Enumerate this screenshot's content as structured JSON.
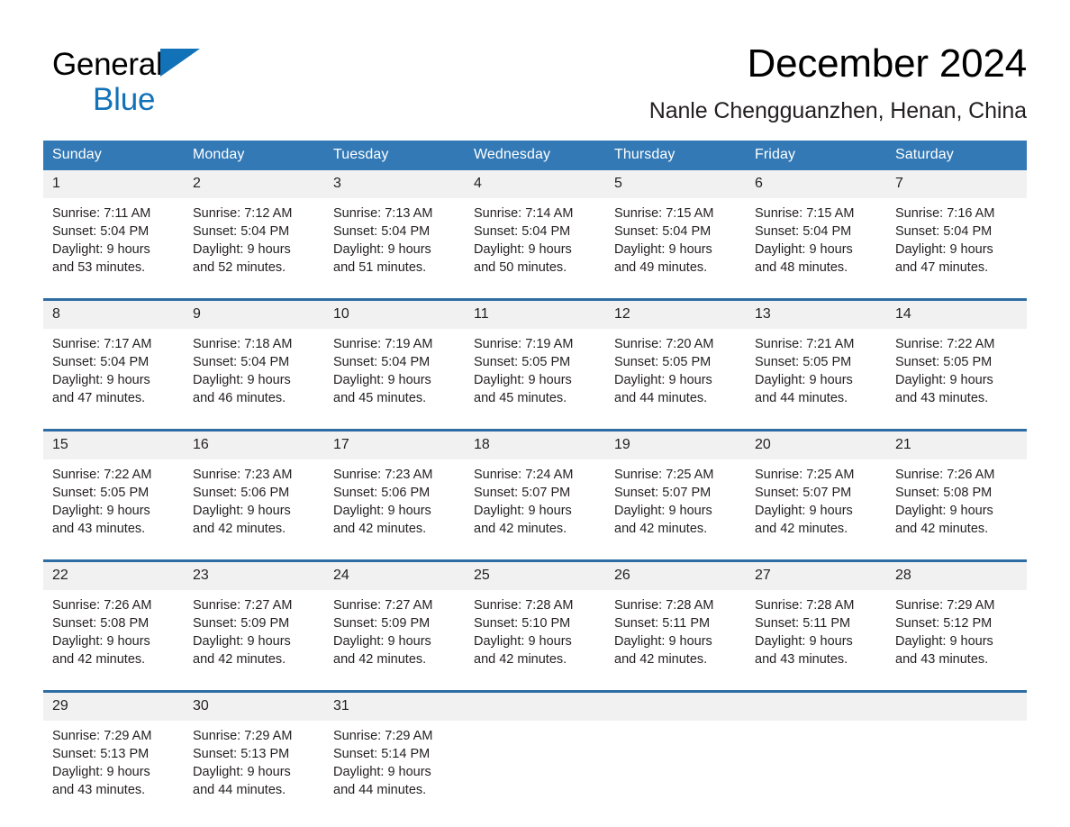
{
  "brand": {
    "name_part1": "General",
    "name_part2": "Blue",
    "triangle_color": "#1272b8",
    "logo_icon": "general-blue-logo-icon"
  },
  "header": {
    "title": "December 2024",
    "subtitle": "Nanle Chengguanzhen, Henan, China"
  },
  "theme": {
    "header_blue": "#3279b6",
    "divider_blue": "#2e6da4",
    "daynum_band": "#f1f1f1",
    "text": "#231f20"
  },
  "weekday_headers": [
    "Sunday",
    "Monday",
    "Tuesday",
    "Wednesday",
    "Thursday",
    "Friday",
    "Saturday"
  ],
  "weeks": [
    [
      {
        "day": "1",
        "sunrise": "Sunrise: 7:11 AM",
        "sunset": "Sunset: 5:04 PM",
        "daylight1": "Daylight: 9 hours",
        "daylight2": "and 53 minutes."
      },
      {
        "day": "2",
        "sunrise": "Sunrise: 7:12 AM",
        "sunset": "Sunset: 5:04 PM",
        "daylight1": "Daylight: 9 hours",
        "daylight2": "and 52 minutes."
      },
      {
        "day": "3",
        "sunrise": "Sunrise: 7:13 AM",
        "sunset": "Sunset: 5:04 PM",
        "daylight1": "Daylight: 9 hours",
        "daylight2": "and 51 minutes."
      },
      {
        "day": "4",
        "sunrise": "Sunrise: 7:14 AM",
        "sunset": "Sunset: 5:04 PM",
        "daylight1": "Daylight: 9 hours",
        "daylight2": "and 50 minutes."
      },
      {
        "day": "5",
        "sunrise": "Sunrise: 7:15 AM",
        "sunset": "Sunset: 5:04 PM",
        "daylight1": "Daylight: 9 hours",
        "daylight2": "and 49 minutes."
      },
      {
        "day": "6",
        "sunrise": "Sunrise: 7:15 AM",
        "sunset": "Sunset: 5:04 PM",
        "daylight1": "Daylight: 9 hours",
        "daylight2": "and 48 minutes."
      },
      {
        "day": "7",
        "sunrise": "Sunrise: 7:16 AM",
        "sunset": "Sunset: 5:04 PM",
        "daylight1": "Daylight: 9 hours",
        "daylight2": "and 47 minutes."
      }
    ],
    [
      {
        "day": "8",
        "sunrise": "Sunrise: 7:17 AM",
        "sunset": "Sunset: 5:04 PM",
        "daylight1": "Daylight: 9 hours",
        "daylight2": "and 47 minutes."
      },
      {
        "day": "9",
        "sunrise": "Sunrise: 7:18 AM",
        "sunset": "Sunset: 5:04 PM",
        "daylight1": "Daylight: 9 hours",
        "daylight2": "and 46 minutes."
      },
      {
        "day": "10",
        "sunrise": "Sunrise: 7:19 AM",
        "sunset": "Sunset: 5:04 PM",
        "daylight1": "Daylight: 9 hours",
        "daylight2": "and 45 minutes."
      },
      {
        "day": "11",
        "sunrise": "Sunrise: 7:19 AM",
        "sunset": "Sunset: 5:05 PM",
        "daylight1": "Daylight: 9 hours",
        "daylight2": "and 45 minutes."
      },
      {
        "day": "12",
        "sunrise": "Sunrise: 7:20 AM",
        "sunset": "Sunset: 5:05 PM",
        "daylight1": "Daylight: 9 hours",
        "daylight2": "and 44 minutes."
      },
      {
        "day": "13",
        "sunrise": "Sunrise: 7:21 AM",
        "sunset": "Sunset: 5:05 PM",
        "daylight1": "Daylight: 9 hours",
        "daylight2": "and 44 minutes."
      },
      {
        "day": "14",
        "sunrise": "Sunrise: 7:22 AM",
        "sunset": "Sunset: 5:05 PM",
        "daylight1": "Daylight: 9 hours",
        "daylight2": "and 43 minutes."
      }
    ],
    [
      {
        "day": "15",
        "sunrise": "Sunrise: 7:22 AM",
        "sunset": "Sunset: 5:05 PM",
        "daylight1": "Daylight: 9 hours",
        "daylight2": "and 43 minutes."
      },
      {
        "day": "16",
        "sunrise": "Sunrise: 7:23 AM",
        "sunset": "Sunset: 5:06 PM",
        "daylight1": "Daylight: 9 hours",
        "daylight2": "and 42 minutes."
      },
      {
        "day": "17",
        "sunrise": "Sunrise: 7:23 AM",
        "sunset": "Sunset: 5:06 PM",
        "daylight1": "Daylight: 9 hours",
        "daylight2": "and 42 minutes."
      },
      {
        "day": "18",
        "sunrise": "Sunrise: 7:24 AM",
        "sunset": "Sunset: 5:07 PM",
        "daylight1": "Daylight: 9 hours",
        "daylight2": "and 42 minutes."
      },
      {
        "day": "19",
        "sunrise": "Sunrise: 7:25 AM",
        "sunset": "Sunset: 5:07 PM",
        "daylight1": "Daylight: 9 hours",
        "daylight2": "and 42 minutes."
      },
      {
        "day": "20",
        "sunrise": "Sunrise: 7:25 AM",
        "sunset": "Sunset: 5:07 PM",
        "daylight1": "Daylight: 9 hours",
        "daylight2": "and 42 minutes."
      },
      {
        "day": "21",
        "sunrise": "Sunrise: 7:26 AM",
        "sunset": "Sunset: 5:08 PM",
        "daylight1": "Daylight: 9 hours",
        "daylight2": "and 42 minutes."
      }
    ],
    [
      {
        "day": "22",
        "sunrise": "Sunrise: 7:26 AM",
        "sunset": "Sunset: 5:08 PM",
        "daylight1": "Daylight: 9 hours",
        "daylight2": "and 42 minutes."
      },
      {
        "day": "23",
        "sunrise": "Sunrise: 7:27 AM",
        "sunset": "Sunset: 5:09 PM",
        "daylight1": "Daylight: 9 hours",
        "daylight2": "and 42 minutes."
      },
      {
        "day": "24",
        "sunrise": "Sunrise: 7:27 AM",
        "sunset": "Sunset: 5:09 PM",
        "daylight1": "Daylight: 9 hours",
        "daylight2": "and 42 minutes."
      },
      {
        "day": "25",
        "sunrise": "Sunrise: 7:28 AM",
        "sunset": "Sunset: 5:10 PM",
        "daylight1": "Daylight: 9 hours",
        "daylight2": "and 42 minutes."
      },
      {
        "day": "26",
        "sunrise": "Sunrise: 7:28 AM",
        "sunset": "Sunset: 5:11 PM",
        "daylight1": "Daylight: 9 hours",
        "daylight2": "and 42 minutes."
      },
      {
        "day": "27",
        "sunrise": "Sunrise: 7:28 AM",
        "sunset": "Sunset: 5:11 PM",
        "daylight1": "Daylight: 9 hours",
        "daylight2": "and 43 minutes."
      },
      {
        "day": "28",
        "sunrise": "Sunrise: 7:29 AM",
        "sunset": "Sunset: 5:12 PM",
        "daylight1": "Daylight: 9 hours",
        "daylight2": "and 43 minutes."
      }
    ],
    [
      {
        "day": "29",
        "sunrise": "Sunrise: 7:29 AM",
        "sunset": "Sunset: 5:13 PM",
        "daylight1": "Daylight: 9 hours",
        "daylight2": "and 43 minutes."
      },
      {
        "day": "30",
        "sunrise": "Sunrise: 7:29 AM",
        "sunset": "Sunset: 5:13 PM",
        "daylight1": "Daylight: 9 hours",
        "daylight2": "and 44 minutes."
      },
      {
        "day": "31",
        "sunrise": "Sunrise: 7:29 AM",
        "sunset": "Sunset: 5:14 PM",
        "daylight1": "Daylight: 9 hours",
        "daylight2": "and 44 minutes."
      },
      {
        "day": "",
        "sunrise": "",
        "sunset": "",
        "daylight1": "",
        "daylight2": ""
      },
      {
        "day": "",
        "sunrise": "",
        "sunset": "",
        "daylight1": "",
        "daylight2": ""
      },
      {
        "day": "",
        "sunrise": "",
        "sunset": "",
        "daylight1": "",
        "daylight2": ""
      },
      {
        "day": "",
        "sunrise": "",
        "sunset": "",
        "daylight1": "",
        "daylight2": ""
      }
    ]
  ]
}
